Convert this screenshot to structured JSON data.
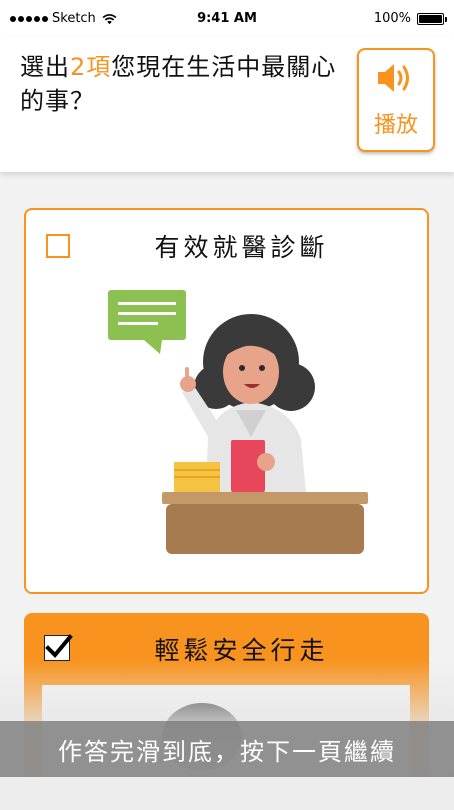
{
  "status_bar": {
    "carrier": "Sketch",
    "time": "9:41 AM",
    "battery": "100%"
  },
  "header": {
    "question_prefix": "選出",
    "question_accent": "2項",
    "question_rest": "您現在生活中最關心的事？",
    "play_label": "播放"
  },
  "options": [
    {
      "label": "有效就醫診斷",
      "checked": false,
      "illustration": "doctor-illustration"
    },
    {
      "label": "輕鬆安全行走",
      "checked": true,
      "illustration": "walking-illustration"
    }
  ],
  "footer": {
    "banner_text": "作答完滑到底，按下一頁繼續"
  },
  "colors": {
    "accent": "#f7931e",
    "banner": "#787878"
  }
}
